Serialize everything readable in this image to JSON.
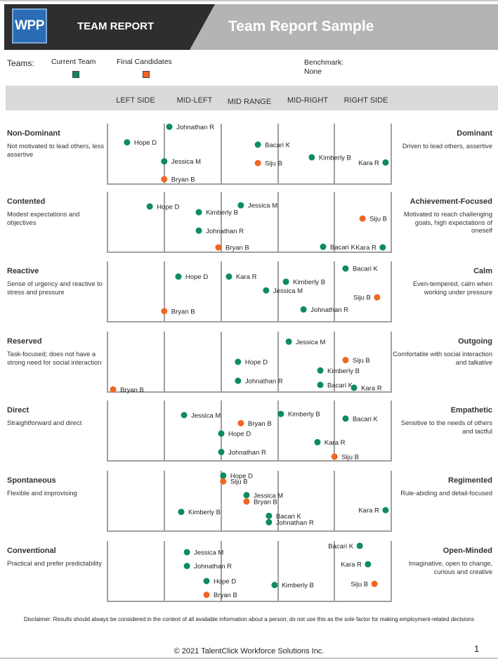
{
  "header": {
    "logo_text": "WPP",
    "report_label": "TEAM REPORT",
    "title": "Team Report Sample"
  },
  "legend": {
    "teams_label": "Teams:",
    "items": [
      {
        "label": "Current Team",
        "color": "#0e8c5c"
      },
      {
        "label": "Final Candidates",
        "color": "#f26522"
      }
    ],
    "benchmark_label": "Benchmark:",
    "benchmark_value": "None"
  },
  "bands": [
    "LEFT SIDE",
    "MID-LEFT",
    "MID RANGE",
    "MID-RIGHT",
    "RIGHT SIDE"
  ],
  "chart_data": {
    "type": "scatter",
    "title": "Team Report Sample",
    "xlim": [
      0,
      100
    ],
    "x_description": "Trait score from left pole (0) to right pole (100); y is vertical offset in plot (0 = top, 1 = baseline) used to separate names",
    "colors": {
      "current": "#0e8c5c",
      "candidate": "#f26522",
      "grid": "#a0a0a0"
    },
    "traits": [
      {
        "left_title": "Non-Dominant",
        "left_desc": "Not motivated to lead others, less assertive",
        "right_title": "Dominant",
        "right_desc": "Driven to lead others, assertive",
        "points": [
          {
            "name": "Johnathan R",
            "team": "current",
            "x": 21.8,
            "y": 0.03,
            "label": "right"
          },
          {
            "name": "Hope D",
            "team": "current",
            "x": 6.9,
            "y": 0.3,
            "label": "right"
          },
          {
            "name": "Bacari K",
            "team": "current",
            "x": 53.0,
            "y": 0.34,
            "label": "right"
          },
          {
            "name": "Kimberly B",
            "team": "current",
            "x": 72.0,
            "y": 0.56,
            "label": "right"
          },
          {
            "name": "Kara R",
            "team": "current",
            "x": 98.0,
            "y": 0.65,
            "label": "left"
          },
          {
            "name": "Jessica M",
            "team": "current",
            "x": 20.0,
            "y": 0.63,
            "label": "right"
          },
          {
            "name": "Siju B",
            "team": "candidate",
            "x": 53.0,
            "y": 0.66,
            "label": "right"
          },
          {
            "name": "Bryan B",
            "team": "candidate",
            "x": 20.0,
            "y": 0.94,
            "label": "right"
          }
        ]
      },
      {
        "left_title": "Contented",
        "left_desc": "Modest expectations and objectives",
        "right_title": "Achievement-Focused",
        "right_desc": "Motivated to reach challenging goals, high expectations of oneself",
        "points": [
          {
            "name": "Hope D",
            "team": "current",
            "x": 14.9,
            "y": 0.23,
            "label": "right"
          },
          {
            "name": "Jessica M",
            "team": "current",
            "x": 47.0,
            "y": 0.21,
            "label": "right"
          },
          {
            "name": "Kimberly B",
            "team": "current",
            "x": 32.2,
            "y": 0.33,
            "label": "right"
          },
          {
            "name": "Siju B",
            "team": "candidate",
            "x": 89.9,
            "y": 0.44,
            "label": "right"
          },
          {
            "name": "Johnathan R",
            "team": "current",
            "x": 32.2,
            "y": 0.65,
            "label": "right"
          },
          {
            "name": "Bryan B",
            "team": "candidate",
            "x": 39.1,
            "y": 0.94,
            "label": "right"
          },
          {
            "name": "Bacari K",
            "team": "current",
            "x": 75.99,
            "y": 0.93,
            "label": "right"
          },
          {
            "name": "Kara R",
            "team": "current",
            "x": 97.0,
            "y": 0.94,
            "label": "left"
          }
        ]
      },
      {
        "left_title": "Reactive",
        "left_desc": "Sense of urgency and reactive to stress and pressure",
        "right_title": "Calm",
        "right_desc": "Even-tempered, calm when working under pressure",
        "points": [
          {
            "name": "Bacari K",
            "team": "current",
            "x": 83.9,
            "y": 0.1,
            "label": "right"
          },
          {
            "name": "Hope D",
            "team": "current",
            "x": 25.0,
            "y": 0.24,
            "label": "right"
          },
          {
            "name": "Kara R",
            "team": "current",
            "x": 42.8,
            "y": 0.24,
            "label": "right"
          },
          {
            "name": "Kimberly B",
            "team": "current",
            "x": 62.9,
            "y": 0.33,
            "label": "right"
          },
          {
            "name": "Jessica M",
            "team": "current",
            "x": 55.9,
            "y": 0.48,
            "label": "right"
          },
          {
            "name": "Siju B",
            "team": "candidate",
            "x": 95.0,
            "y": 0.6,
            "label": "left"
          },
          {
            "name": "Johnathan R",
            "team": "current",
            "x": 69.1,
            "y": 0.81,
            "label": "right"
          },
          {
            "name": "Bryan B",
            "team": "candidate",
            "x": 20.0,
            "y": 0.84,
            "label": "right"
          }
        ]
      },
      {
        "left_title": "Reserved",
        "left_desc": "Task-focused; does not have a strong need for social interaction",
        "right_title": "Outgoing",
        "right_desc": "Comfortable with social interaction and talkative",
        "points": [
          {
            "name": "Jessica M",
            "team": "current",
            "x": 63.9,
            "y": 0.15,
            "label": "right"
          },
          {
            "name": "Siju B",
            "team": "candidate",
            "x": 83.9,
            "y": 0.47,
            "label": "right"
          },
          {
            "name": "Hope D",
            "team": "current",
            "x": 46.0,
            "y": 0.5,
            "label": "right"
          },
          {
            "name": "Kimberly B",
            "team": "current",
            "x": 75.0,
            "y": 0.65,
            "label": "right"
          },
          {
            "name": "Johnathan R",
            "team": "current",
            "x": 46.0,
            "y": 0.83,
            "label": "right"
          },
          {
            "name": "Bacari K",
            "team": "current",
            "x": 75.0,
            "y": 0.9,
            "label": "right"
          },
          {
            "name": "Kara R",
            "team": "current",
            "x": 86.9,
            "y": 0.95,
            "label": "right"
          },
          {
            "name": "Bryan B",
            "team": "candidate",
            "x": 2.0,
            "y": 0.98,
            "label": "right"
          }
        ]
      },
      {
        "left_title": "Direct",
        "left_desc": "Straightforward and direct",
        "right_title": "Empathetic",
        "right_desc": "Sensitive to the needs of others and tactful",
        "points": [
          {
            "name": "Kimberly B",
            "team": "current",
            "x": 61.1,
            "y": 0.21,
            "label": "right"
          },
          {
            "name": "Jessica M",
            "team": "current",
            "x": 27.0,
            "y": 0.23,
            "label": "right"
          },
          {
            "name": "Bacari K",
            "team": "current",
            "x": 83.9,
            "y": 0.29,
            "label": "right"
          },
          {
            "name": "Bryan B",
            "team": "candidate",
            "x": 47.0,
            "y": 0.37,
            "label": "right"
          },
          {
            "name": "Hope D",
            "team": "current",
            "x": 40.1,
            "y": 0.55,
            "label": "right"
          },
          {
            "name": "Kara R",
            "team": "current",
            "x": 73.99,
            "y": 0.7,
            "label": "right"
          },
          {
            "name": "Johnathan R",
            "team": "current",
            "x": 40.1,
            "y": 0.87,
            "label": "right"
          },
          {
            "name": "Siju B",
            "team": "candidate",
            "x": 80.0,
            "y": 0.95,
            "label": "right"
          }
        ]
      },
      {
        "left_title": "Spontaneous",
        "left_desc": "Flexible and improvising",
        "right_title": "Regimented",
        "right_desc": "Rule-abiding and detail-focused",
        "points": [
          {
            "name": "Hope D",
            "team": "current",
            "x": 40.8,
            "y": 0.06,
            "label": "right"
          },
          {
            "name": "Siju B",
            "team": "candidate",
            "x": 40.8,
            "y": 0.16,
            "label": "right"
          },
          {
            "name": "Jessica M",
            "team": "current",
            "x": 49.0,
            "y": 0.4,
            "label": "right"
          },
          {
            "name": "Bryan B",
            "team": "candidate",
            "x": 49.0,
            "y": 0.51,
            "label": "right"
          },
          {
            "name": "Kimberly B",
            "team": "current",
            "x": 25.99,
            "y": 0.69,
            "label": "right"
          },
          {
            "name": "Kara R",
            "team": "current",
            "x": 98.0,
            "y": 0.66,
            "label": "left"
          },
          {
            "name": "Bacari K",
            "team": "current",
            "x": 56.9,
            "y": 0.76,
            "label": "right"
          },
          {
            "name": "Johnathan R",
            "team": "current",
            "x": 56.9,
            "y": 0.87,
            "label": "right"
          }
        ]
      },
      {
        "left_title": "Conventional",
        "left_desc": "Practical and prefer predictability",
        "right_title": "Open-Minded",
        "right_desc": "Imaginative, open to change, curious and creative",
        "points": [
          {
            "name": "Bacari K",
            "team": "current",
            "x": 88.9,
            "y": 0.06,
            "label": "left"
          },
          {
            "name": "Jessica M",
            "team": "current",
            "x": 28.0,
            "y": 0.17,
            "label": "right"
          },
          {
            "name": "Kara R",
            "team": "current",
            "x": 91.8,
            "y": 0.38,
            "label": "left"
          },
          {
            "name": "Johnathan R",
            "team": "current",
            "x": 28.0,
            "y": 0.41,
            "label": "right"
          },
          {
            "name": "Hope D",
            "team": "current",
            "x": 34.9,
            "y": 0.67,
            "label": "right"
          },
          {
            "name": "Siju B",
            "team": "candidate",
            "x": 94.1,
            "y": 0.72,
            "label": "left"
          },
          {
            "name": "Kimberly B",
            "team": "current",
            "x": 58.9,
            "y": 0.74,
            "label": "right"
          },
          {
            "name": "Bryan B",
            "team": "candidate",
            "x": 34.9,
            "y": 0.91,
            "label": "right"
          }
        ]
      }
    ]
  },
  "footer": {
    "disclaimer": "Disclaimer: Results should always be considered in the context of all available information about a person; do not use this as the sole factor for making employment-related decisions",
    "copyright": "© 2021 TalentClick Workforce Solutions Inc.",
    "page_number": "1"
  }
}
